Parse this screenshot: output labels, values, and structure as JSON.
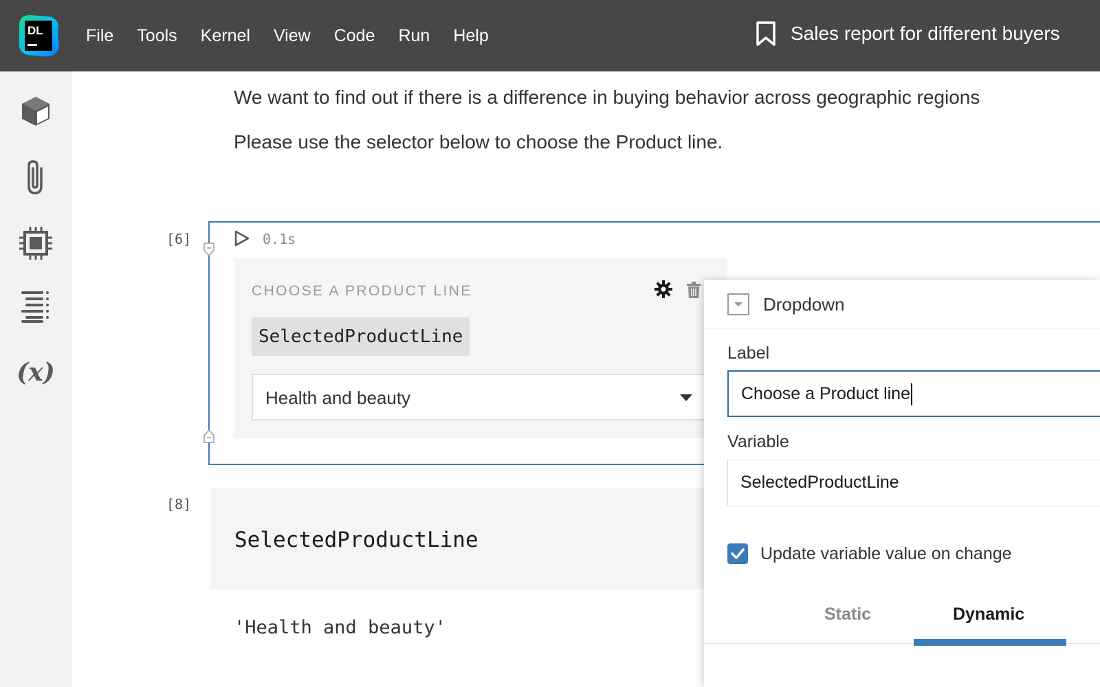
{
  "app": {
    "logo_text": "DL",
    "menu": [
      "File",
      "Tools",
      "Kernel",
      "View",
      "Code",
      "Run",
      "Help"
    ],
    "doc_title": "Sales report for different buyers"
  },
  "sidebar": {
    "icons": [
      "package-icon",
      "paperclip-icon",
      "cpu-icon",
      "outline-icon",
      "variables-icon"
    ],
    "variables_glyph": "(x)"
  },
  "markdown": {
    "line1": "We want to find out if there is a difference in buying behavior across geographic regions",
    "line2": "Please use the selector below to choose the Product line."
  },
  "cell1": {
    "exec_count": "[6]",
    "exec_time": "0.1s",
    "widget": {
      "label": "CHOOSE A PRODUCT LINE",
      "variable": "SelectedProductLine",
      "selected_value": "Health and beauty"
    }
  },
  "cell2": {
    "exec_count": "[8]",
    "code": "SelectedProductLine",
    "output": "'Health and beauty'"
  },
  "panel": {
    "title": "Dropdown",
    "label_field": {
      "label": "Label",
      "value": "Choose a Product line"
    },
    "variable_field": {
      "label": "Variable",
      "value": "SelectedProductLine"
    },
    "checkbox": {
      "label": "Update variable value on change",
      "checked": true
    },
    "tabs": [
      {
        "label": "Static",
        "active": false
      },
      {
        "label": "Dynamic",
        "active": true
      }
    ]
  },
  "colors": {
    "topbar": "#474747",
    "accent": "#3d7ab8",
    "widget_bg": "#f5f5f5",
    "sidebar_bg": "#f2f2f2"
  }
}
